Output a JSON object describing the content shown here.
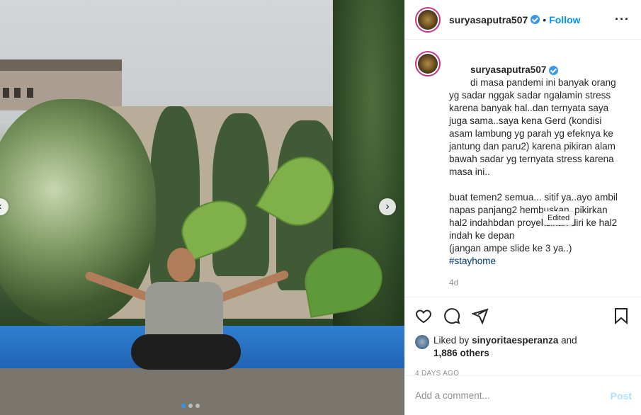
{
  "post": {
    "username": "suryasaputra507",
    "follow_label": "Follow",
    "separator": "•",
    "more_icon": "more-horizontal-icon",
    "caption_lines": [
      "di masa pandemi ini banyak orang yg sadar nggak sadar ngalamin stress karena banyak hal..dan ternyata saya juga sama..saya kena Gerd (kondisi asam lambung yg parah yg efeknya ke jantung dan paru2) karena pikiran alam bawah sadar yg ternyata stress karena masa ini..",
      "buat temen2 semua...",
      "sitif ya..ayo ambil napas panjang2 hembuskan..pikirkan hal2 indahbdan proyeksikan diri ke hal2 indah ke depan",
      "(jangan ampe slide ke 3 ya..)"
    ],
    "hashtag": "#stayhome",
    "time_ago": "4d",
    "edited_tooltip": "Edited",
    "liked_by_prefix": "Liked by",
    "liked_by_user": "sinyoritaesperanza",
    "liked_by_and": "and",
    "likes_count": "1,886 others",
    "date": "4 DAYS AGO",
    "comment_placeholder": "Add a comment...",
    "post_label": "Post"
  },
  "carousel": {
    "next_icon": "chevron-right-icon",
    "prev_icon": "chevron-left-icon",
    "dots_total": 3,
    "active_dot": 1
  },
  "colors": {
    "accent": "#0095f6",
    "verified": "#3897f0",
    "post_disabled": "#b2dffc",
    "muted": "#8e8e8e"
  }
}
